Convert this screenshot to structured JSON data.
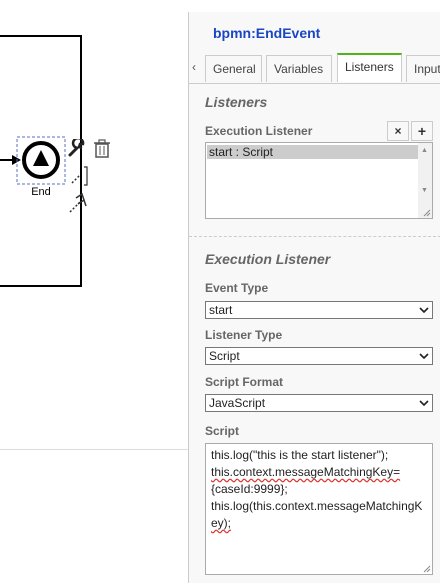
{
  "canvas": {
    "element_label": "End",
    "tools": [
      "wrench-icon",
      "trash-icon",
      "connect-icon",
      "more-icon"
    ]
  },
  "panel": {
    "title": "bpmn:EndEvent",
    "tabs": [
      {
        "label": "General",
        "active": false
      },
      {
        "label": "Variables",
        "active": false
      },
      {
        "label": "Listeners",
        "active": true
      },
      {
        "label": "Input/Output",
        "active": false
      }
    ],
    "listeners": {
      "heading": "Listeners",
      "execution_label": "Execution Listener",
      "remove_label": "×",
      "add_label": "+",
      "items": [
        "start : Script"
      ]
    },
    "detail": {
      "heading": "Execution Listener",
      "event_type_label": "Event Type",
      "event_type_value": "start",
      "listener_type_label": "Listener Type",
      "listener_type_value": "Script",
      "script_format_label": "Script Format",
      "script_format_value": "JavaScript",
      "script_label": "Script",
      "script_lines": [
        "this.log(\"this is the start listener\");",
        "this.context.messageMatchingKey=",
        "{caseId:9999};",
        "this.log(this.context.messageMatchingK",
        "ey);"
      ]
    }
  },
  "colors": {
    "title": "#1a46c4",
    "active_tab_accent": "#52b415",
    "selection_handle": "#5a6fc4"
  }
}
